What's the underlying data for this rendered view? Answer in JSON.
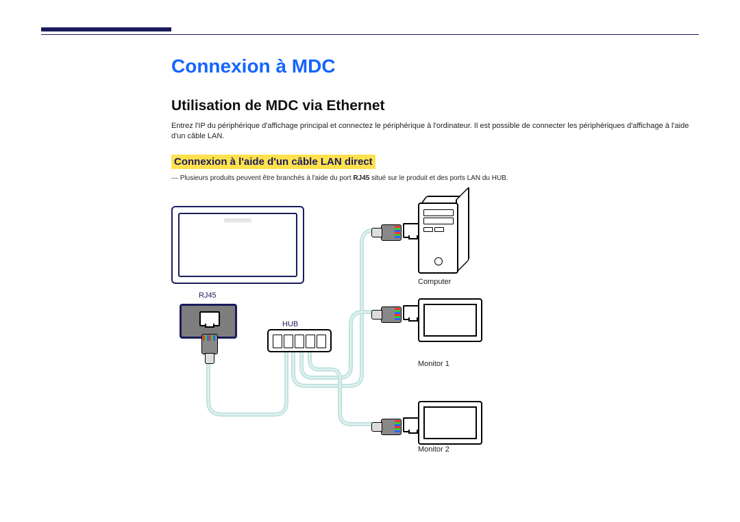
{
  "title": "Connexion à MDC",
  "subtitle": "Utilisation de MDC via Ethernet",
  "intro": "Entrez l'IP du périphérique d'affichage principal et connectez le périphérique à l'ordinateur. Il est possible de connecter les périphériques d'affichage à l'aide d'un câble LAN.",
  "highlight": "Connexion à l'aide d'un câble LAN direct",
  "note_prefix": "―",
  "note_before": "Plusieurs produits peuvent être branchés à l'aide du port ",
  "note_strong": "RJ45",
  "note_after": " situé sur le produit et des ports LAN du HUB.",
  "labels": {
    "rj45": "RJ45",
    "hub": "HUB",
    "computer": "Computer",
    "monitor1": "Monitor 1",
    "monitor2": "Monitor 2"
  }
}
